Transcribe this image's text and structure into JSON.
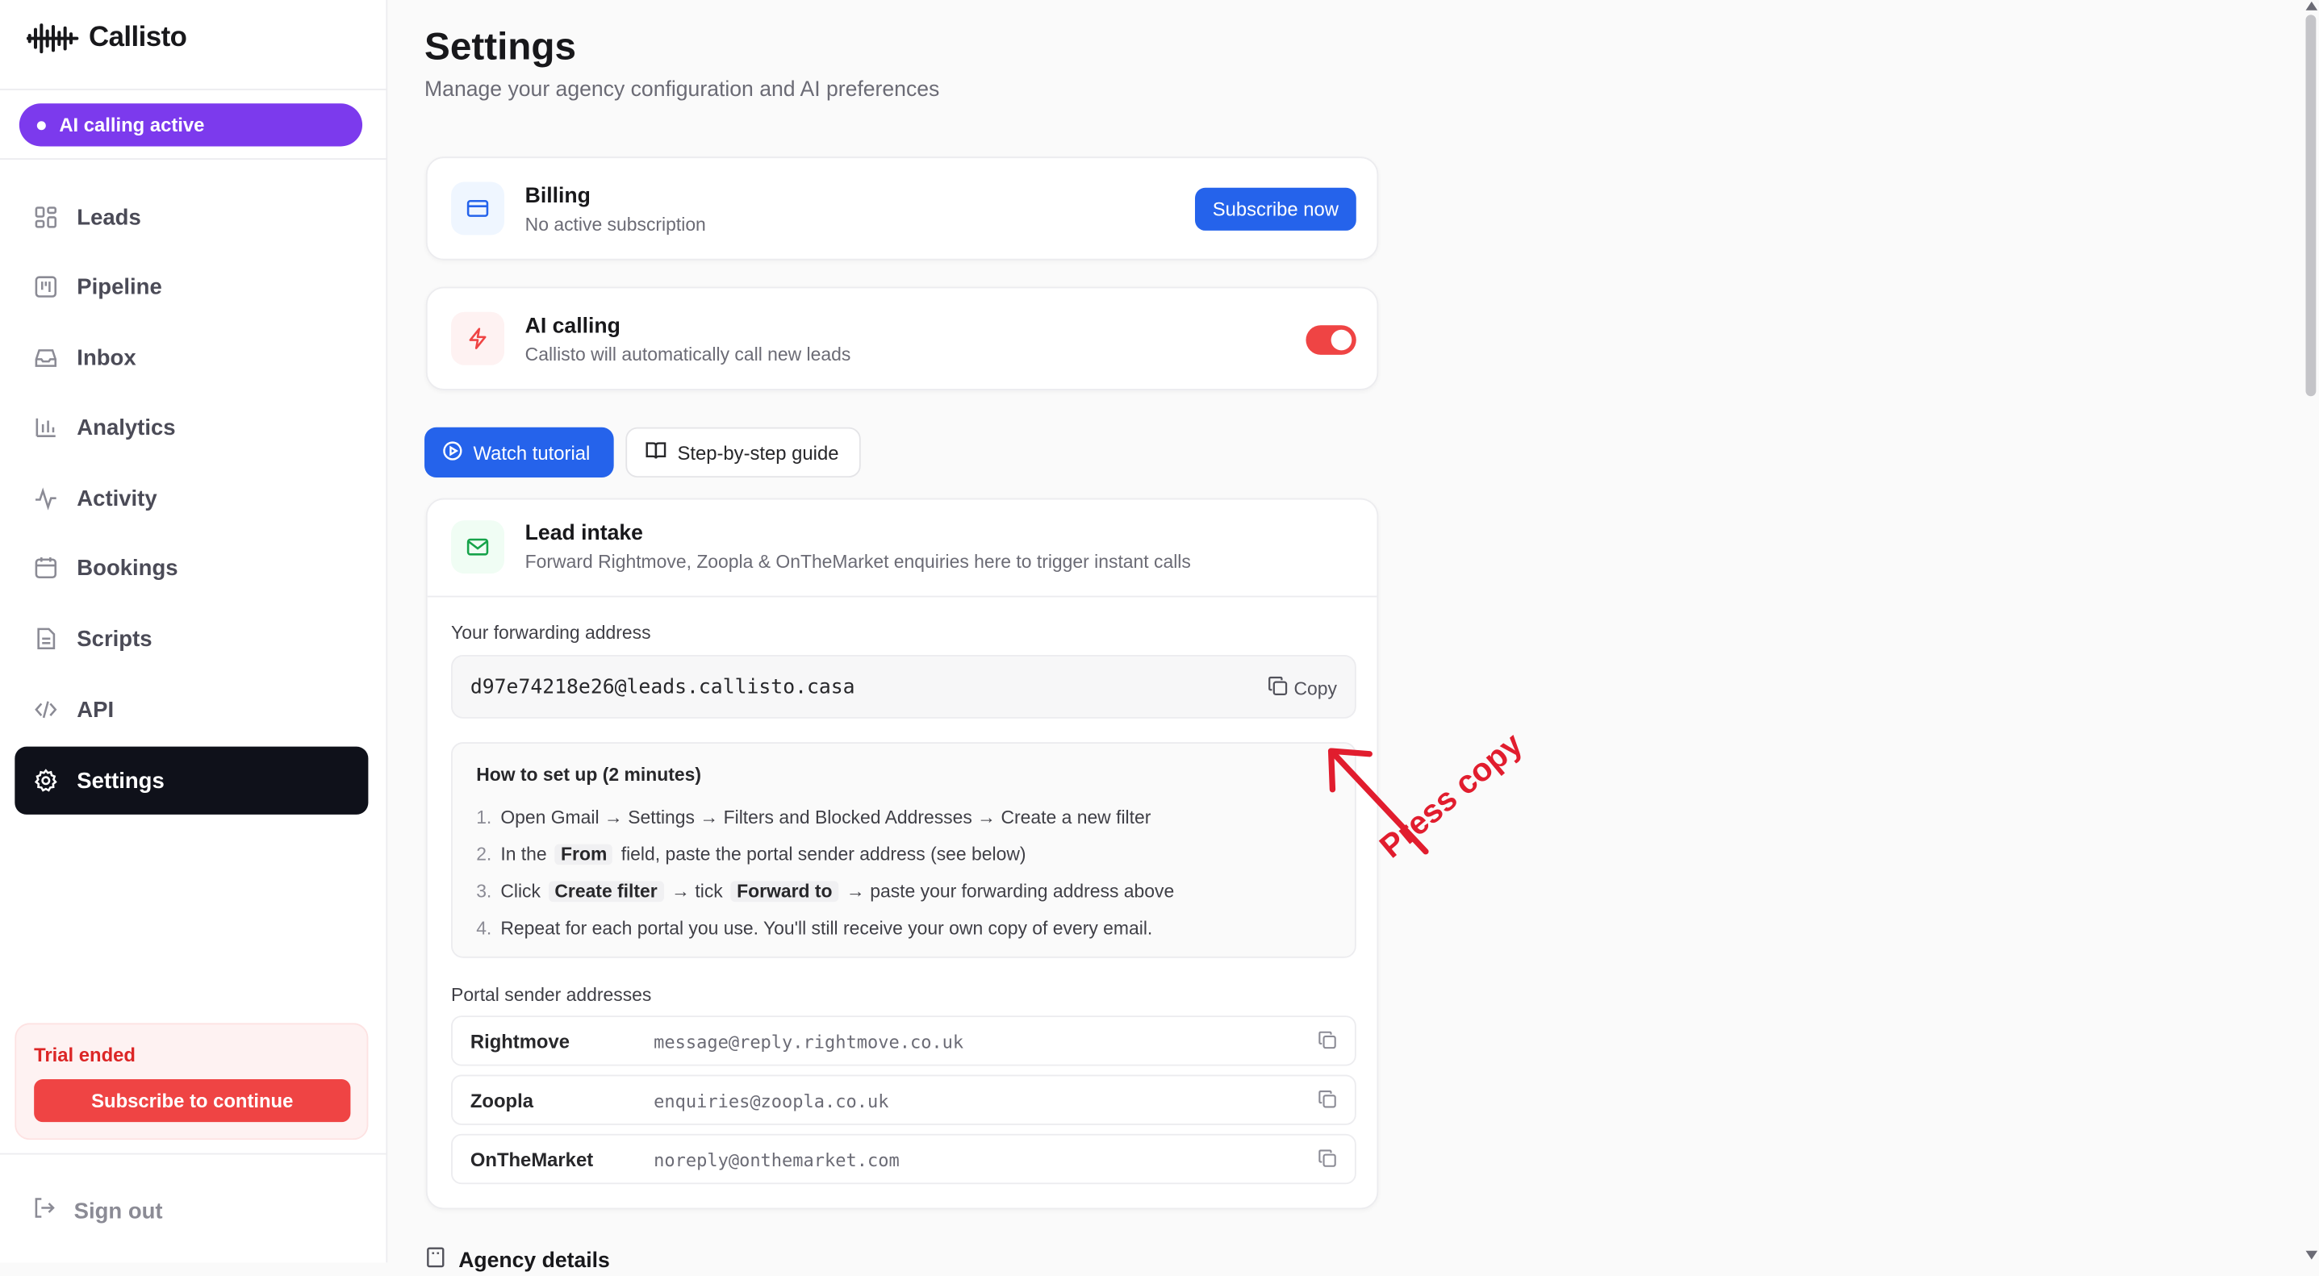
{
  "app": {
    "name": "Callisto"
  },
  "sidebar": {
    "status_pill": "AI calling active",
    "items": [
      {
        "label": "Leads",
        "icon": "grid-icon"
      },
      {
        "label": "Pipeline",
        "icon": "kanban-icon"
      },
      {
        "label": "Inbox",
        "icon": "inbox-icon"
      },
      {
        "label": "Analytics",
        "icon": "bar-chart-icon"
      },
      {
        "label": "Activity",
        "icon": "activity-icon"
      },
      {
        "label": "Bookings",
        "icon": "calendar-icon"
      },
      {
        "label": "Scripts",
        "icon": "file-text-icon"
      },
      {
        "label": "API",
        "icon": "code-icon"
      },
      {
        "label": "Settings",
        "icon": "gear-icon",
        "active": true
      }
    ],
    "trial": {
      "title": "Trial ended",
      "button": "Subscribe to continue"
    },
    "sign_out": "Sign out"
  },
  "page": {
    "title": "Settings",
    "subtitle": "Manage your agency configuration and AI preferences"
  },
  "billing": {
    "title": "Billing",
    "subtitle": "No active subscription",
    "button": "Subscribe now"
  },
  "ai_calling": {
    "title": "AI calling",
    "subtitle": "Callisto will automatically call new leads",
    "enabled": true
  },
  "tabs": {
    "watch": "Watch tutorial",
    "guide": "Step-by-step guide"
  },
  "lead_intake": {
    "title": "Lead intake",
    "subtitle": "Forward Rightmove, Zoopla & OnTheMarket enquiries here to trigger instant calls",
    "forwarding_label": "Your forwarding address",
    "forwarding_address": "d97e74218e26@leads.callisto.casa",
    "copy_label": "Copy",
    "howto_title": "How to set up (2 minutes)",
    "steps": [
      {
        "n": "1.",
        "pre": "Open Gmail → Settings → Filters and Blocked Addresses → Create a new filter"
      },
      {
        "n": "2.",
        "pre": "In the",
        "code": "From",
        "post": "field, paste the portal sender address (see below)"
      },
      {
        "n": "3.",
        "pre": "Click",
        "code": "Create filter",
        "mid": "→ tick",
        "code2": "Forward to",
        "post": "→ paste your forwarding address above"
      },
      {
        "n": "4.",
        "pre": "Repeat for each portal you use. You'll still receive your own copy of every email."
      }
    ],
    "portals_label": "Portal sender addresses",
    "portals": [
      {
        "name": "Rightmove",
        "email": "message@reply.rightmove.co.uk"
      },
      {
        "name": "Zoopla",
        "email": "enquiries@zoopla.co.uk"
      },
      {
        "name": "OnTheMarket",
        "email": "noreply@onthemarket.com"
      }
    ]
  },
  "agency_details": {
    "title": "Agency details"
  },
  "annotation": {
    "text": "Press copy",
    "color": "#e11d2e"
  },
  "colors": {
    "accent": "#2563eb",
    "purple": "#7c3aed",
    "danger": "#ef4444",
    "dark": "#0f111a"
  }
}
